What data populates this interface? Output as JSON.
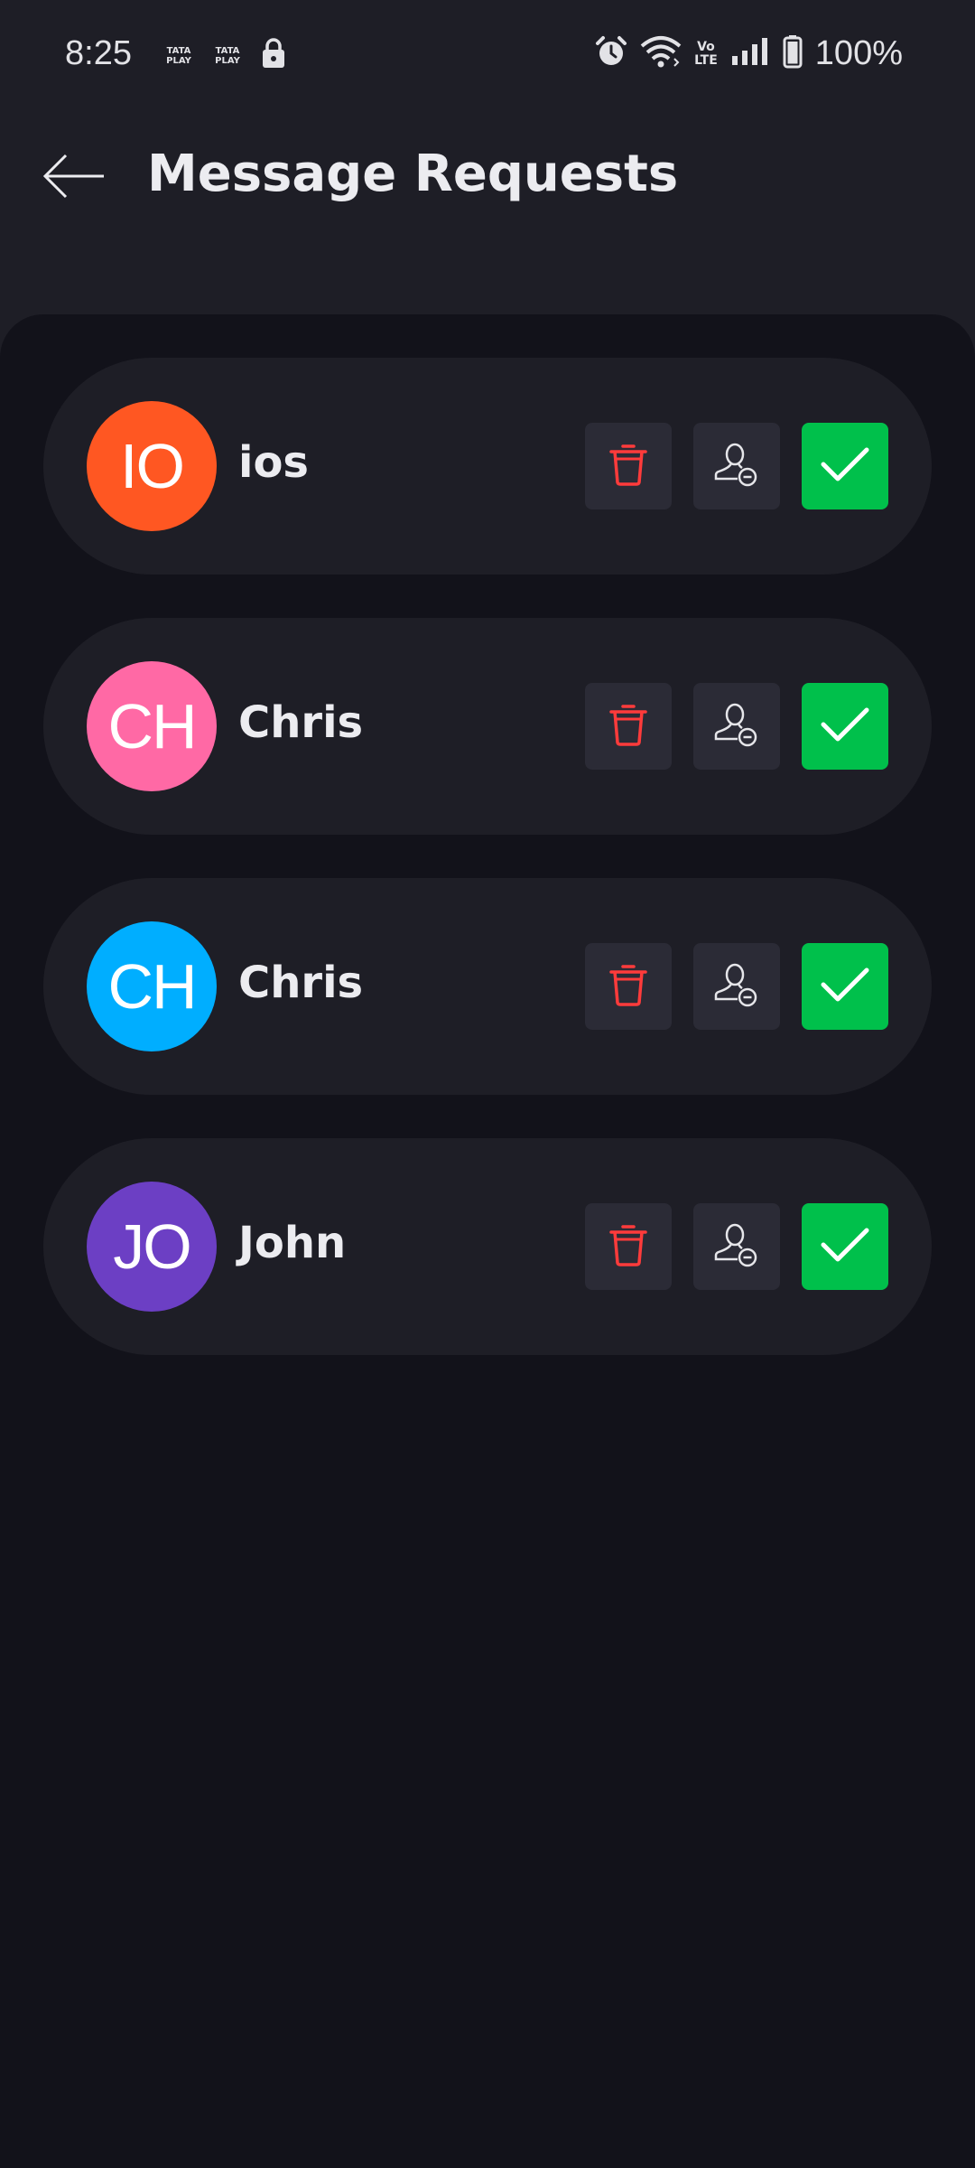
{
  "status_bar": {
    "time": "8:25",
    "carrier_badges": [
      "TATA PLAY",
      "TATA PLAY"
    ],
    "network_label": "Vo LTE",
    "battery": "100%",
    "icons": [
      "lock-icon",
      "alarm-icon",
      "wifi-icon",
      "signal-icon",
      "battery-icon"
    ]
  },
  "header": {
    "title": "Message Requests",
    "back_icon": "arrow-left-icon"
  },
  "requests": [
    {
      "initials": "IO",
      "name": "ios",
      "avatar_color": "#ff5722"
    },
    {
      "initials": "CH",
      "name": "Chris",
      "avatar_color": "#ff69a5"
    },
    {
      "initials": "CH",
      "name": "Chris",
      "avatar_color": "#00aeff"
    },
    {
      "initials": "JO",
      "name": "John",
      "avatar_color": "#6c3fc4"
    }
  ],
  "actions": {
    "delete_icon": "trash-icon",
    "block_icon": "user-block-icon",
    "accept_icon": "check-icon"
  },
  "colors": {
    "background": "#1e1e26",
    "panel": "#12121a",
    "card": "#1e1e26",
    "action_button": "#2b2b36",
    "accept": "#00c04b",
    "delete_icon": "#ff3b3b"
  }
}
